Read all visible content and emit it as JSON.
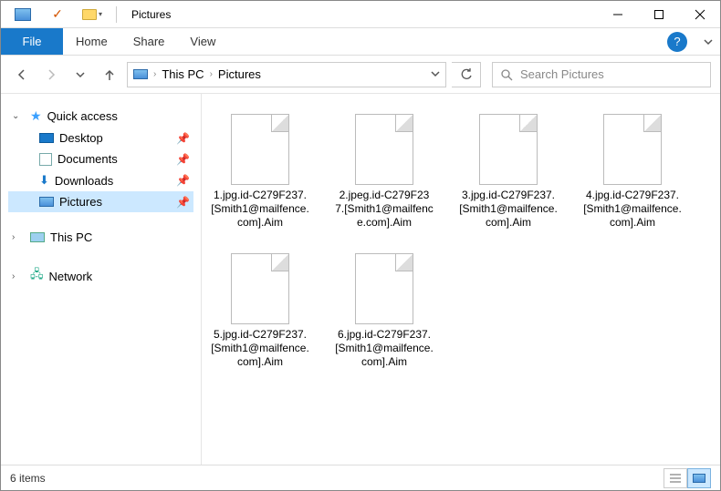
{
  "window": {
    "title": "Pictures"
  },
  "ribbon": {
    "file": "File",
    "tabs": [
      "Home",
      "Share",
      "View"
    ]
  },
  "breadcrumb": {
    "root": "This PC",
    "current": "Pictures"
  },
  "search": {
    "placeholder": "Search Pictures"
  },
  "sidebar": {
    "quick_access": "Quick access",
    "items": [
      {
        "label": "Desktop"
      },
      {
        "label": "Documents"
      },
      {
        "label": "Downloads"
      },
      {
        "label": "Pictures"
      }
    ],
    "this_pc": "This PC",
    "network": "Network"
  },
  "files": [
    {
      "name": "1.jpg.id-C279F237.[Smith1@mailfence.com].Aim"
    },
    {
      "name": "2.jpeg.id-C279F237.[Smith1@mailfence.com].Aim"
    },
    {
      "name": "3.jpg.id-C279F237.[Smith1@mailfence.com].Aim"
    },
    {
      "name": "4.jpg.id-C279F237.[Smith1@mailfence.com].Aim"
    },
    {
      "name": "5.jpg.id-C279F237.[Smith1@mailfence.com].Aim"
    },
    {
      "name": "6.jpg.id-C279F237.[Smith1@mailfence.com].Aim"
    }
  ],
  "statusbar": {
    "count_text": "6 items"
  }
}
